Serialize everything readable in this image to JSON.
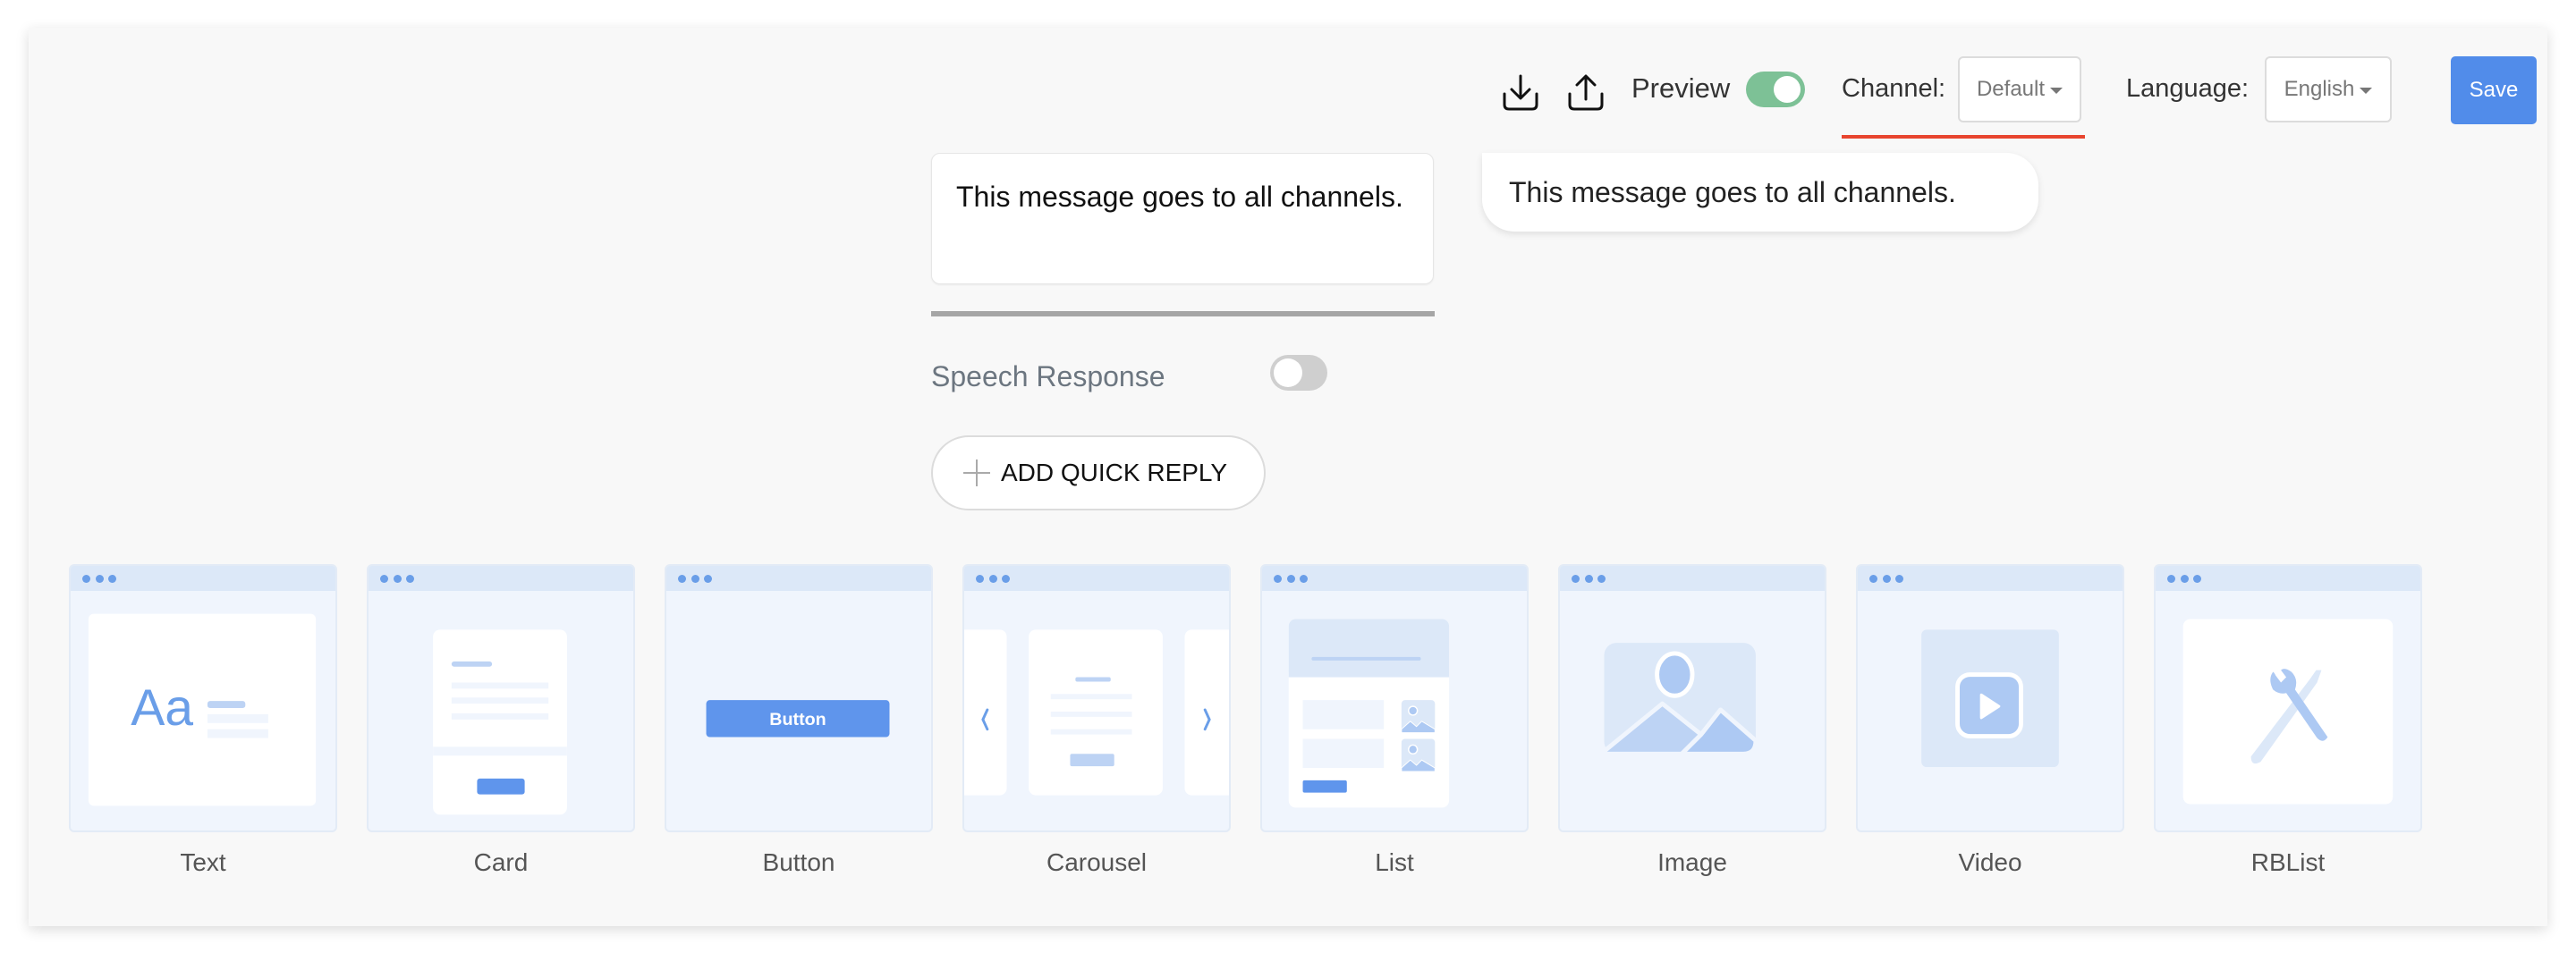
{
  "toolbar": {
    "download_icon": "download-icon",
    "upload_icon": "upload-icon",
    "preview_label": "Preview",
    "preview_enabled": true,
    "channel_label": "Channel:",
    "channel_value": "Default",
    "language_label": "Language:",
    "language_value": "English",
    "save_label": "Save"
  },
  "colors": {
    "accent": "#518cea",
    "toggle_on": "#7dc196",
    "toggle_off": "#cfcfcf",
    "channel_underline": "#e8452f"
  },
  "editor": {
    "message_text": "This message goes to all channels.",
    "preview_text": "This message goes to all channels.",
    "speech_response_label": "Speech Response",
    "speech_response_enabled": false,
    "add_quick_reply_label": "ADD QUICK REPLY"
  },
  "templates": [
    {
      "label": "Text",
      "icon": "text-template-icon",
      "glyph": "Aa"
    },
    {
      "label": "Card",
      "icon": "card-template-icon"
    },
    {
      "label": "Button",
      "icon": "button-template-icon",
      "glyph": "Button"
    },
    {
      "label": "Carousel",
      "icon": "carousel-template-icon"
    },
    {
      "label": "List",
      "icon": "list-template-icon"
    },
    {
      "label": "Image",
      "icon": "image-template-icon"
    },
    {
      "label": "Video",
      "icon": "video-template-icon"
    },
    {
      "label": "RBList",
      "icon": "rblist-template-icon"
    }
  ]
}
